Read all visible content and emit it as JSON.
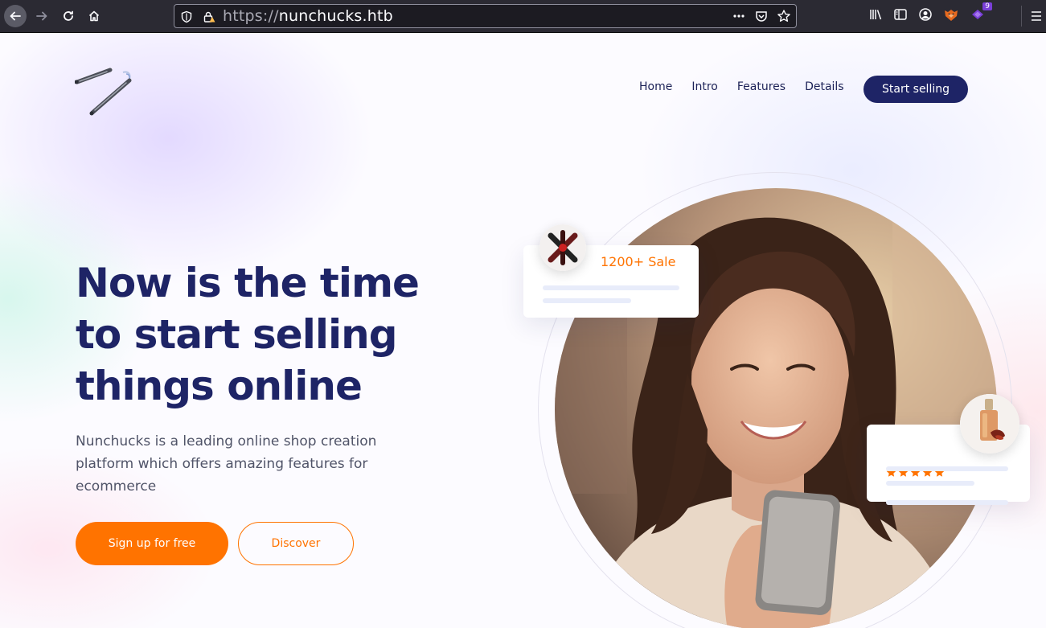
{
  "browser": {
    "url_scheme": "https://",
    "url_host": "nunchucks.htb",
    "extension_badge": "9"
  },
  "nav": {
    "items": [
      "Home",
      "Intro",
      "Features",
      "Details"
    ],
    "cta": "Start selling"
  },
  "hero": {
    "title_lines": [
      "Now is the time",
      "to start selling",
      "things online"
    ],
    "subtitle_lines": [
      "Nunchucks is a leading online shop creation",
      "platform which offers amazing features for",
      "ecommerce"
    ],
    "primary_button": "Sign up for free",
    "secondary_button": "Discover"
  },
  "cards": {
    "sale_label": "1200+ Sale",
    "rating_stars": 5
  },
  "colors": {
    "brand_navy": "#1e2466",
    "accent_orange": "#ff7300",
    "browser_bg": "#2b2a33"
  },
  "icons": [
    "back-arrow-icon",
    "forward-arrow-icon",
    "reload-icon",
    "home-icon",
    "tracking-shield-icon",
    "insecure-lock-icon",
    "page-actions-icon",
    "pocket-icon",
    "bookmark-star-icon",
    "library-icon",
    "sidebar-icon",
    "account-icon",
    "extension-fox-icon",
    "extension-purple-icon",
    "hamburger-menu-icon",
    "nunchuck-logo-icon",
    "star-icon"
  ]
}
